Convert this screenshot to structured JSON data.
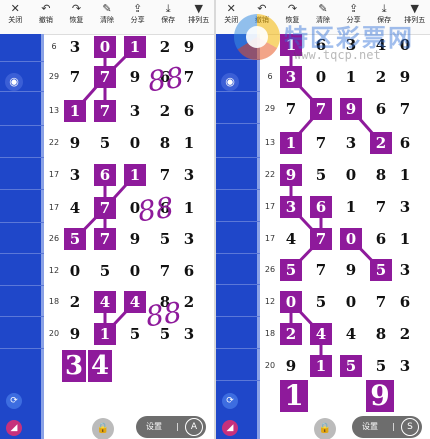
{
  "watermark": {
    "title": "特区彩票网",
    "url": "www.tqcp.net"
  },
  "left": {
    "toolbar": [
      {
        "icon": "✕",
        "label": "关闭",
        "name": "close"
      },
      {
        "icon": "↶",
        "label": "撤销",
        "name": "undo"
      },
      {
        "icon": "↷",
        "label": "恢复",
        "name": "redo"
      },
      {
        "icon": "✎",
        "label": "清除",
        "name": "clear"
      },
      {
        "icon": "⇪",
        "label": "分享",
        "name": "share"
      },
      {
        "icon": "⤓",
        "label": "保存",
        "name": "save"
      },
      {
        "icon": "▼",
        "label": "排列五",
        "name": "arrange-five"
      }
    ],
    "rows": [
      {
        "label": "6",
        "digits": [
          "3",
          "0",
          "1",
          "2",
          "9"
        ]
      },
      {
        "label": "29",
        "digits": [
          "7",
          "7",
          "9",
          "6",
          "7"
        ]
      },
      {
        "label": "13",
        "digits": [
          "1",
          "7",
          "3",
          "2",
          "6"
        ]
      },
      {
        "label": "22",
        "digits": [
          "9",
          "5",
          "0",
          "8",
          "1"
        ]
      },
      {
        "label": "17",
        "digits": [
          "3",
          "6",
          "1",
          "7",
          "3"
        ]
      },
      {
        "label": "17",
        "digits": [
          "4",
          "7",
          "0",
          "6",
          "1"
        ]
      },
      {
        "label": "26",
        "digits": [
          "5",
          "7",
          "9",
          "5",
          "3"
        ]
      },
      {
        "label": "12",
        "digits": [
          "0",
          "5",
          "0",
          "7",
          "6"
        ]
      },
      {
        "label": "18",
        "digits": [
          "2",
          "4",
          "4",
          "8",
          "2"
        ]
      },
      {
        "label": "20",
        "digits": [
          "9",
          "1",
          "5",
          "5",
          "3"
        ]
      }
    ],
    "big": [
      "3",
      "4"
    ],
    "scribble": [
      "88",
      "88",
      "88"
    ],
    "settings_label": "设置",
    "settings_sep": "|",
    "settings_icon": "A"
  },
  "right": {
    "toolbar": [
      {
        "icon": "✕",
        "label": "关闭",
        "name": "close"
      },
      {
        "icon": "↶",
        "label": "撤销",
        "name": "undo"
      },
      {
        "icon": "↷",
        "label": "恢复",
        "name": "redo"
      },
      {
        "icon": "✎",
        "label": "清除",
        "name": "clear"
      },
      {
        "icon": "⇪",
        "label": "分享",
        "name": "share"
      },
      {
        "icon": "⤓",
        "label": "保存",
        "name": "save"
      },
      {
        "icon": "▼",
        "label": "排列五",
        "name": "arrange-five"
      }
    ],
    "rows": [
      {
        "label": "",
        "digits": [
          "1",
          "6",
          "3",
          "4",
          "0"
        ]
      },
      {
        "label": "6",
        "digits": [
          "3",
          "0",
          "1",
          "2",
          "9"
        ]
      },
      {
        "label": "29",
        "digits": [
          "7",
          "7",
          "9",
          "6",
          "7"
        ]
      },
      {
        "label": "13",
        "digits": [
          "1",
          "7",
          "3",
          "2",
          "6"
        ]
      },
      {
        "label": "22",
        "digits": [
          "9",
          "5",
          "0",
          "8",
          "1"
        ]
      },
      {
        "label": "17",
        "digits": [
          "3",
          "6",
          "1",
          "7",
          "3"
        ]
      },
      {
        "label": "17",
        "digits": [
          "4",
          "7",
          "0",
          "6",
          "1"
        ]
      },
      {
        "label": "26",
        "digits": [
          "5",
          "7",
          "9",
          "5",
          "3"
        ]
      },
      {
        "label": "12",
        "digits": [
          "0",
          "5",
          "0",
          "7",
          "6"
        ]
      },
      {
        "label": "18",
        "digits": [
          "2",
          "4",
          "4",
          "8",
          "2"
        ]
      },
      {
        "label": "20",
        "digits": [
          "9",
          "1",
          "5",
          "5",
          "3"
        ]
      }
    ],
    "big": [
      "1",
      "9"
    ],
    "settings_label": "设置",
    "settings_sep": "|",
    "settings_icon": "S"
  },
  "colors": {
    "highlight": "#8e1a9b",
    "sidebar": "#1f47c9"
  }
}
